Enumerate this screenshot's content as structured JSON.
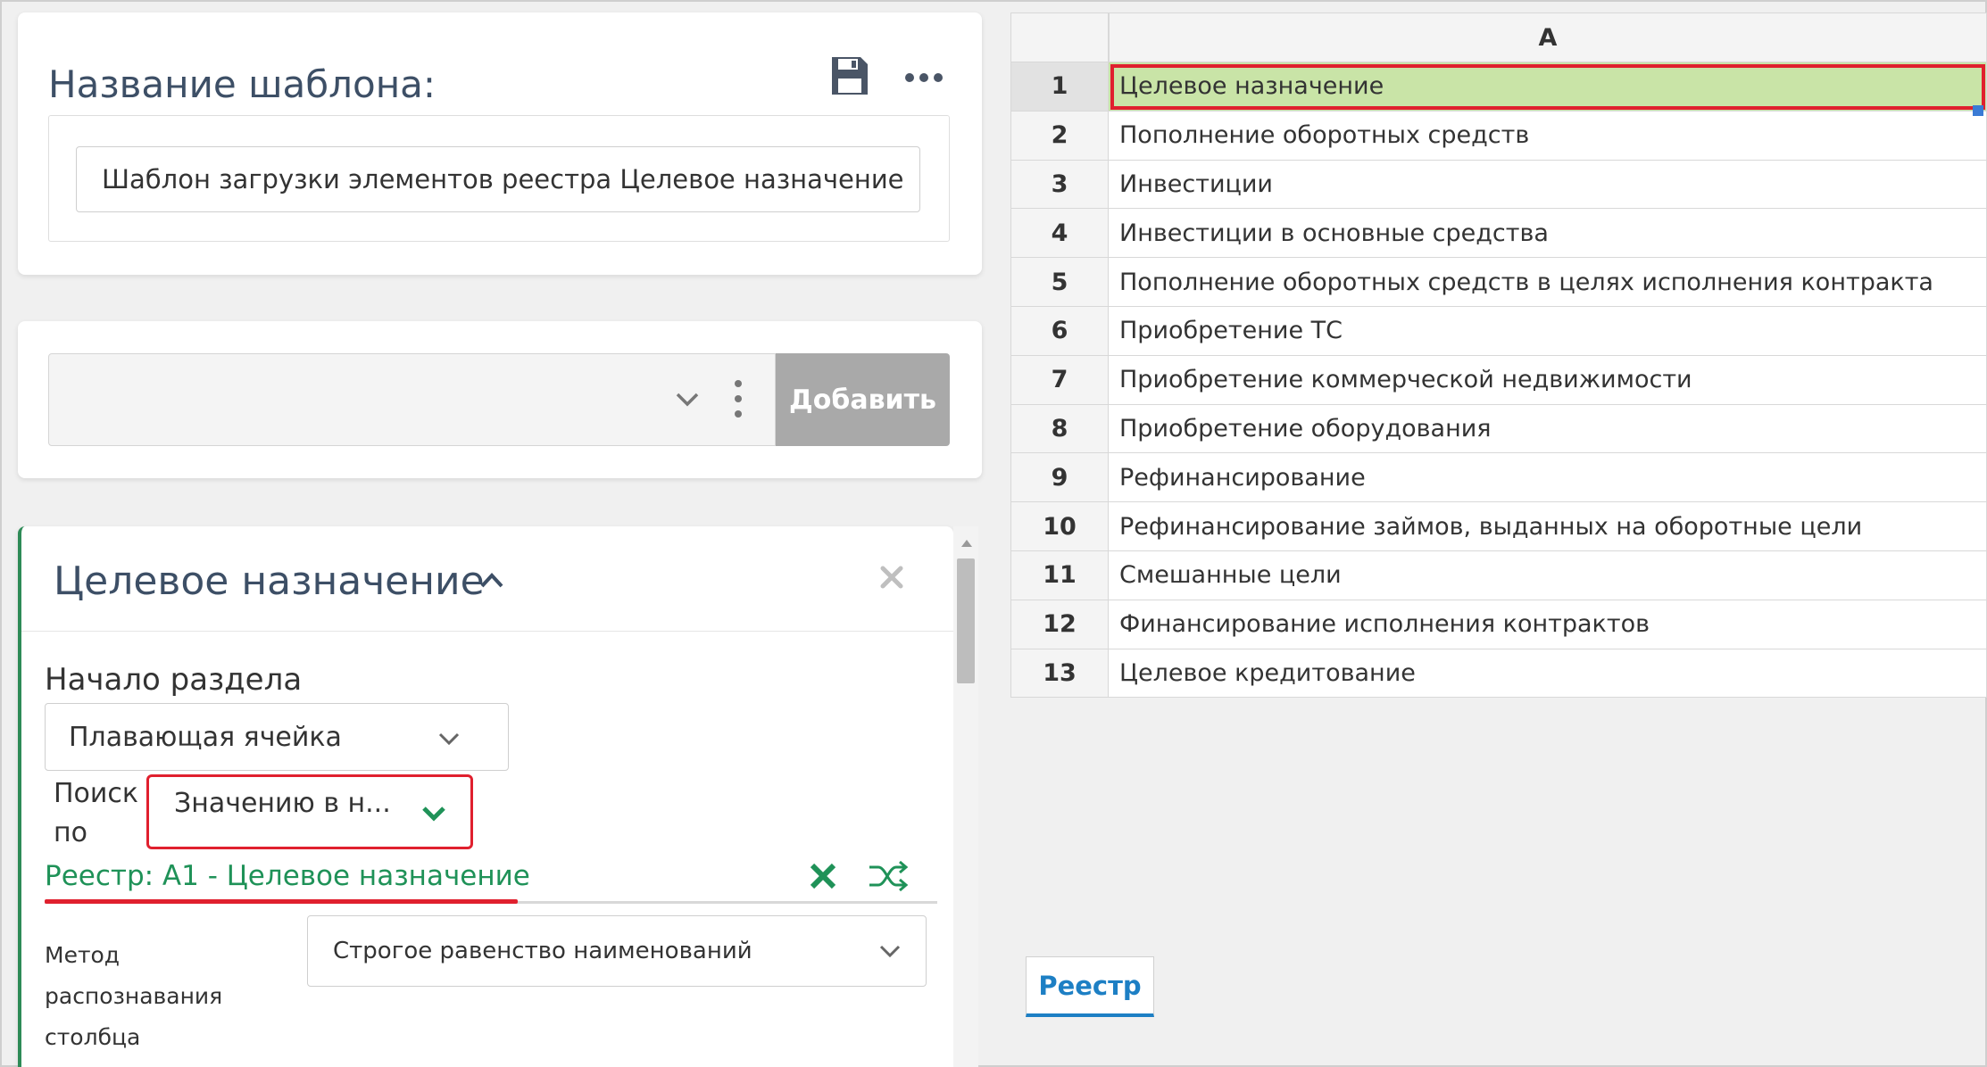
{
  "template_card": {
    "title": "Название шаблона:",
    "name_value": "Шаблон загрузки элементов реестра Целевое назначение"
  },
  "add_card": {
    "select_value": "",
    "add_button": "Добавить"
  },
  "section": {
    "title": "Целевое назначение",
    "start_label": "Начало раздела",
    "start_value": "Плавающая ячейка",
    "search_label": "Поиск по",
    "search_value": "Значению в н...",
    "registry_link": "Реестр: A1 - Целевое назначение",
    "method_label": "Метод распознавания столбца",
    "method_value": "Строгое равенство наименований"
  },
  "sheet": {
    "column_header": "A",
    "rows": [
      {
        "num": "1",
        "value": "Целевое назначение"
      },
      {
        "num": "2",
        "value": "Пополнение оборотных средств"
      },
      {
        "num": "3",
        "value": "Инвестиции"
      },
      {
        "num": "4",
        "value": "Инвестиции в основные средства"
      },
      {
        "num": "5",
        "value": "Пополнение оборотных средств в целях исполнения контракта"
      },
      {
        "num": "6",
        "value": "Приобретение ТС"
      },
      {
        "num": "7",
        "value": "Приобретение коммерческой недвижимости"
      },
      {
        "num": "8",
        "value": "Приобретение оборудования"
      },
      {
        "num": "9",
        "value": "Рефинансирование"
      },
      {
        "num": "10",
        "value": "Рефинансирование займов, выданных на оборотные цели"
      },
      {
        "num": "11",
        "value": "Смешанные цели"
      },
      {
        "num": "12",
        "value": "Финансирование исполнения контрактов"
      },
      {
        "num": "13",
        "value": "Целевое кредитование"
      }
    ],
    "selected_row": "1",
    "tab_label": "Реестр"
  },
  "colors": {
    "accent_green": "#1f9258",
    "highlight_red": "#e0202e",
    "selected_cell": "#c9e4a7",
    "tab_blue": "#1d7fc4"
  },
  "icons": [
    "save-icon",
    "more-icon",
    "chevron-down-icon",
    "vertical-dots-icon",
    "collapse-icon",
    "close-icon",
    "remove-x-icon",
    "shuffle-icon",
    "scroll-up-icon"
  ]
}
